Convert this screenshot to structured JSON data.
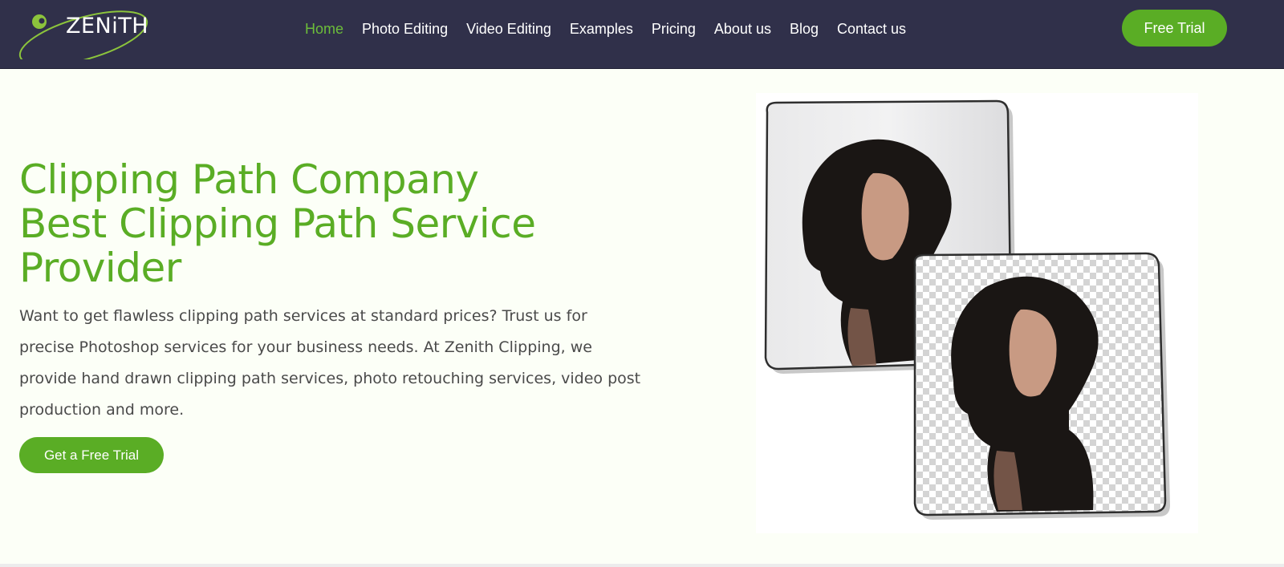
{
  "header": {
    "logo_text": "ZENiTH",
    "nav": [
      {
        "label": "Home",
        "active": true
      },
      {
        "label": "Photo Editing",
        "active": false
      },
      {
        "label": "Video Editing",
        "active": false
      },
      {
        "label": "Examples",
        "active": false
      },
      {
        "label": "Pricing",
        "active": false
      },
      {
        "label": "About us",
        "active": false
      },
      {
        "label": "Blog",
        "active": false
      },
      {
        "label": "Contact us",
        "active": false
      }
    ],
    "cta_label": "Free Trial"
  },
  "hero": {
    "title_lines": [
      "Clipping Path Company",
      "Best Clipping Path Service",
      "Provider"
    ],
    "description": "Want to get flawless clipping path services at standard prices? Trust us for precise Photoshop services for your business needs. At Zenith Clipping, we provide hand drawn clipping path services, photo retouching services, video post production and more.",
    "cta_label": "Get a Free Trial"
  },
  "colors": {
    "brand_green": "#5aad25",
    "header_bg": "#30304a",
    "page_bg": "#fcfff7",
    "active_nav": "#6cbd3a"
  },
  "icons": {
    "logo": "zenith-orbit-logo-icon",
    "before_image": "woman-portrait-original-image",
    "after_image": "woman-portrait-cutout-image"
  }
}
